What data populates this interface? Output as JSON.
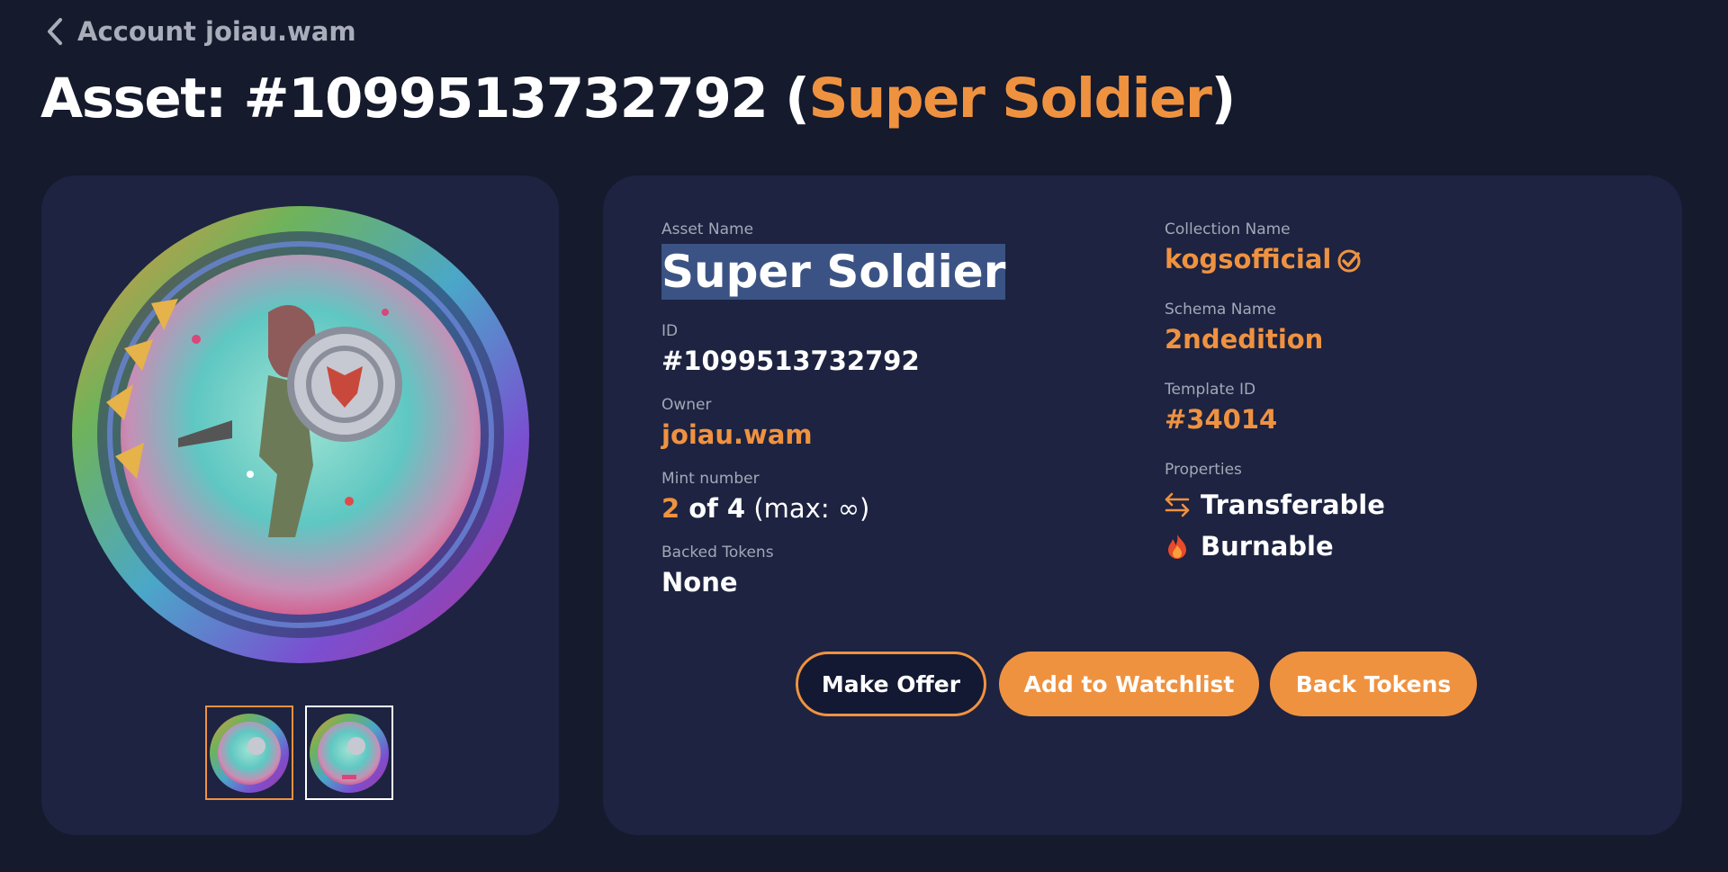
{
  "nav": {
    "back_label": "Account joiau.wam"
  },
  "title": {
    "prefix": "Asset: #1099513732792 (",
    "name": "Super Soldier",
    "suffix": ")"
  },
  "asset": {
    "name_label": "Asset Name",
    "name": "Super Soldier",
    "id_label": "ID",
    "id": "#1099513732792",
    "owner_label": "Owner",
    "owner": "joiau.wam",
    "mint_label": "Mint number",
    "mint_number": "2",
    "mint_of": " of 4",
    "mint_max": " (max: ∞)",
    "backed_label": "Backed Tokens",
    "backed": "None"
  },
  "collection": {
    "name_label": "Collection Name",
    "name": "kogsofficial",
    "schema_label": "Schema Name",
    "schema": "2ndedition",
    "template_label": "Template ID",
    "template": "#34014",
    "properties_label": "Properties",
    "properties": [
      {
        "label": "Transferable",
        "icon": "transfer-arrows-icon"
      },
      {
        "label": "Burnable",
        "icon": "fire-icon"
      }
    ]
  },
  "actions": {
    "offer": "Make Offer",
    "watchlist": "Add to Watchlist",
    "back_tokens": "Back Tokens"
  },
  "colors": {
    "accent": "#ef9240",
    "background": "#151a2d",
    "panel": "#1d2340",
    "highlight": "#3b5384"
  }
}
